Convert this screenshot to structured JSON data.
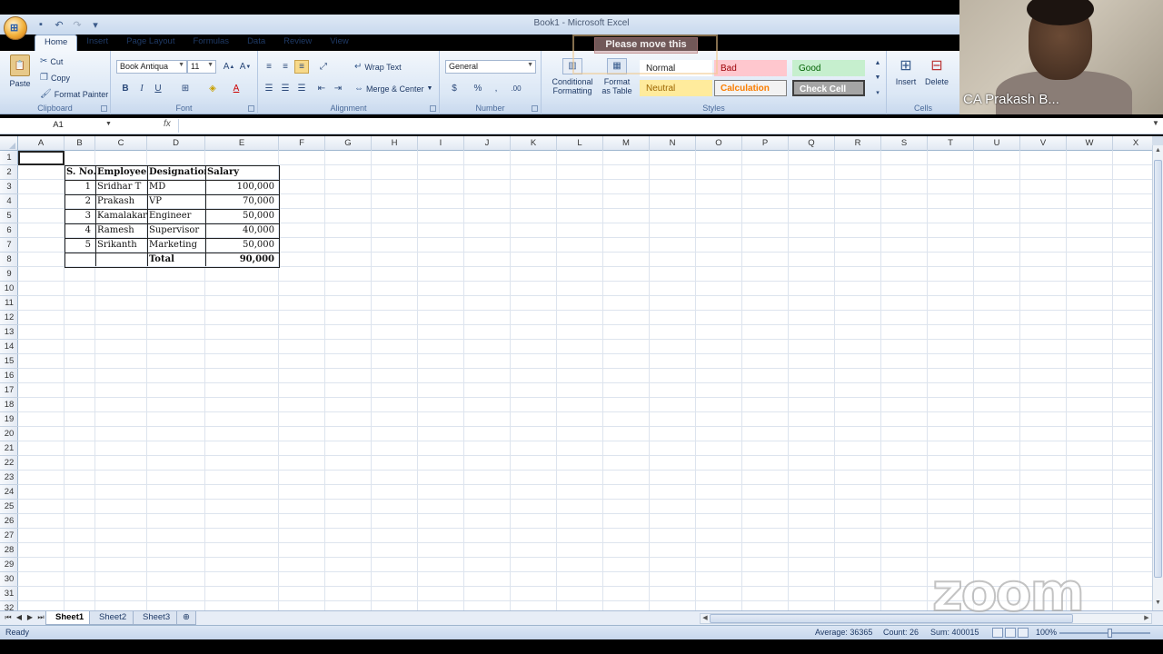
{
  "window": {
    "title": "Book1 - Microsoft Excel",
    "qat": [
      "save-icon",
      "undo-icon",
      "redo-icon",
      "customize-icon"
    ]
  },
  "tabs": [
    "Home",
    "Insert",
    "Page Layout",
    "Formulas",
    "Data",
    "Review",
    "View"
  ],
  "active_tab": "Home",
  "ribbon": {
    "clipboard": {
      "label": "Clipboard",
      "paste": "Paste",
      "cut": "Cut",
      "copy": "Copy",
      "format_painter": "Format Painter"
    },
    "font": {
      "label": "Font",
      "font_name": "Book Antiqua",
      "font_size": "11",
      "bold": "B",
      "italic": "I",
      "underline": "U"
    },
    "alignment": {
      "label": "Alignment",
      "wrap_text": "Wrap Text",
      "merge_center": "Merge & Center"
    },
    "number": {
      "label": "Number",
      "format": "General",
      "currency": "$",
      "percent": "%",
      "comma": ",",
      "inc_dec": ".00"
    },
    "styles": {
      "label": "Styles",
      "conditional_formatting": "Conditional Formatting",
      "format_as_table": "Format as Table",
      "cells": [
        {
          "name": "Normal",
          "color": "#ffffff",
          "text": "#222222"
        },
        {
          "name": "Bad",
          "color": "#ffc7ce",
          "text": "#9c0006"
        },
        {
          "name": "Good",
          "color": "#c6efce",
          "text": "#006100"
        },
        {
          "name": "Neutral",
          "color": "#ffeb9c",
          "text": "#9c6500"
        },
        {
          "name": "Calculation",
          "color": "#f2f2f2",
          "text": "#fa7d00"
        },
        {
          "name": "Check Cell",
          "color": "#a5a5a5",
          "text": "#ffffff"
        }
      ]
    },
    "cells": {
      "label": "Cells",
      "insert": "Insert",
      "delete": "Delete"
    }
  },
  "notice": "Please move this",
  "formula_bar": {
    "name_box": "A1",
    "fx": "fx",
    "value": ""
  },
  "grid": {
    "columns": [
      "A",
      "B",
      "C",
      "D",
      "E",
      "F",
      "G",
      "H",
      "I",
      "J",
      "K",
      "L",
      "M",
      "N",
      "O",
      "P",
      "Q",
      "R",
      "S",
      "T",
      "U",
      "V",
      "W",
      "X"
    ],
    "rows": [
      "1",
      "2",
      "3",
      "4",
      "5",
      "6",
      "7",
      "8",
      "9",
      "10",
      "11",
      "12",
      "13",
      "14",
      "15",
      "16",
      "17",
      "18",
      "19",
      "20",
      "21",
      "22",
      "23",
      "24",
      "25",
      "26",
      "27",
      "28",
      "29",
      "30",
      "31",
      "32"
    ],
    "table": {
      "headers": [
        "S. No.",
        "Employee",
        "Designation",
        "Salary"
      ],
      "rows": [
        [
          "1",
          "Sridhar T",
          "MD",
          "100,000"
        ],
        [
          "2",
          "Prakash",
          "VP",
          "70,000"
        ],
        [
          "3",
          "Kamalakar",
          "Engineer",
          "50,000"
        ],
        [
          "4",
          "Ramesh",
          "Supervisor",
          "40,000"
        ],
        [
          "5",
          "Srikanth",
          "Marketing",
          "50,000"
        ]
      ],
      "total_label": "Total",
      "total_value": "90,000"
    }
  },
  "sheets": [
    "Sheet1",
    "Sheet2",
    "Sheet3"
  ],
  "active_sheet": "Sheet1",
  "status": {
    "ready": "Ready",
    "average": "Average: 36365",
    "count": "Count: 26",
    "sum": "Sum: 400015",
    "zoom": "100%"
  },
  "webcam": {
    "name": "CA Prakash B..."
  },
  "watermark": "zoom"
}
